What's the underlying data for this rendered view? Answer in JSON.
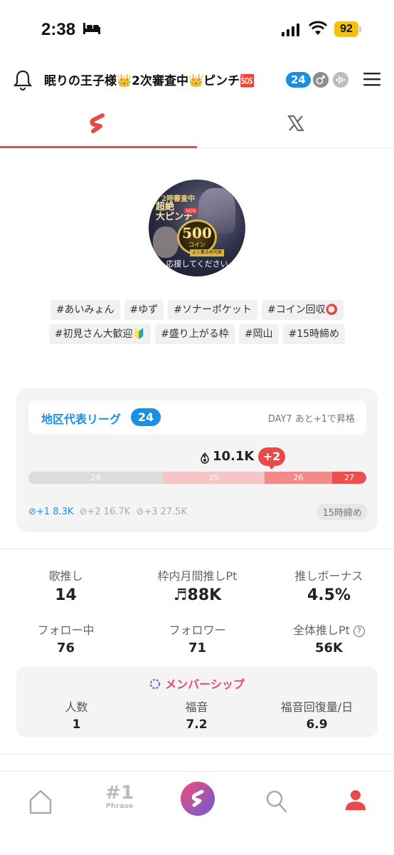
{
  "status_bar": {
    "time": "2:38",
    "battery": "92"
  },
  "header": {
    "title": "眠りの王子様👑2次審査中👑ピンチ🆘",
    "count_badge": "24",
    "icons": [
      "bell-icon",
      "male-icon",
      "voice-icon",
      "menu-icon"
    ]
  },
  "tabs": [
    {
      "name": "app-logo",
      "active": true
    },
    {
      "name": "x-logo",
      "active": false
    }
  ],
  "avatar": {
    "top_text": "2時審査中",
    "main_line1": "超絶",
    "main_line2": "大ピンチ",
    "sos": "SOS",
    "coin_number": "500",
    "coin_text": "コイン",
    "banner": "よく集る枠代表",
    "bottom_text": "応援してください"
  },
  "tags": {
    "row1": [
      "#あいみょん",
      "#ゆず",
      "#ソナーポケット",
      "#コイン回収⭕"
    ],
    "row2": [
      "#初見さん大歓迎🔰",
      "#盛り上がる枠",
      "#岡山",
      "#15時締め"
    ]
  },
  "league": {
    "title": "地区代表リーグ",
    "badge": "24",
    "note": "DAY7 あと+1で昇格",
    "score": "10.1K",
    "rank_change": "+2",
    "segments": [
      {
        "label": "24",
        "color": "#dcdcdc"
      },
      {
        "label": "25",
        "color": "#f6c5c5"
      },
      {
        "label": "26",
        "color": "#f28a8a"
      },
      {
        "label": "27",
        "color": "#ea4e4e"
      }
    ],
    "thresholds": [
      {
        "label": "+1",
        "value": "8.3K"
      },
      {
        "label": "+2",
        "value": "16.7K"
      },
      {
        "label": "+3",
        "value": "27.5K"
      }
    ],
    "deadline": "15時締め"
  },
  "stats": {
    "row1": [
      {
        "label": "歌推し",
        "value": "14"
      },
      {
        "label": "枠内月間推しPt",
        "value": "♬88K"
      },
      {
        "label": "推しボーナス",
        "value": "4.5%"
      }
    ],
    "row2": [
      {
        "label": "フォロー中",
        "value": "76"
      },
      {
        "label": "フォロワー",
        "value": "71"
      },
      {
        "label": "全体推しPt",
        "value": "56K"
      }
    ]
  },
  "membership": {
    "title": "メンバーシップ",
    "items": [
      {
        "label": "人数",
        "value": "1"
      },
      {
        "label": "福音",
        "value": "7.2"
      },
      {
        "label": "福音回復量/日",
        "value": "6.9"
      }
    ]
  },
  "bottom_nav": {
    "phrase_hash": "#1",
    "phrase_label": "Phrase",
    "accent": "#e84a4a"
  }
}
